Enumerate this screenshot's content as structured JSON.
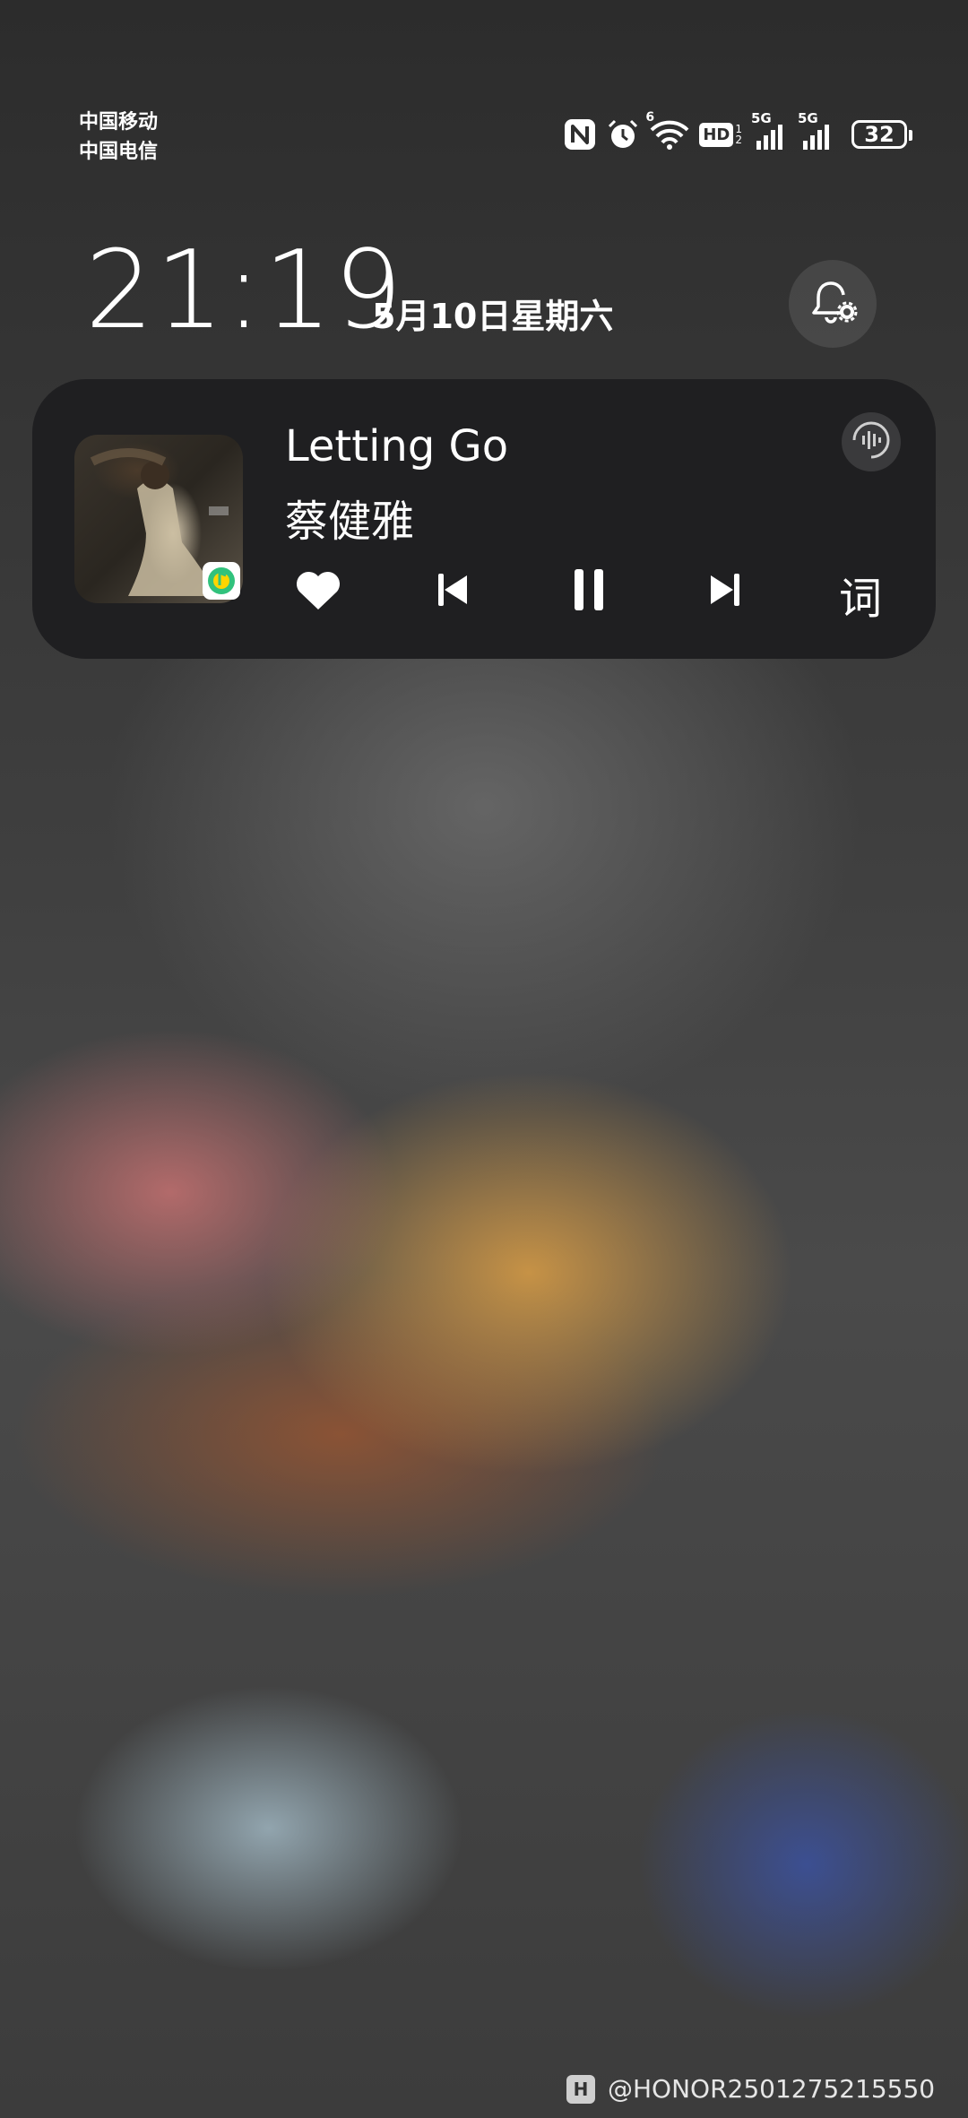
{
  "status_bar": {
    "carrier_1": "中国移动",
    "carrier_2": "中国电信",
    "wifi_label": "6",
    "hd_label": "HD",
    "hd_sim": "1\n2",
    "net1": "5G",
    "net2": "5G",
    "battery": "32",
    "icons": [
      "nfc-icon",
      "alarm-icon",
      "wifi-icon",
      "hd-voice-icon",
      "signal-icon",
      "signal-icon",
      "battery-icon"
    ]
  },
  "lockscreen": {
    "time": "21:19",
    "date": "5月10日星期六"
  },
  "music": {
    "title": "Letting Go",
    "artist": "蔡健雅",
    "lyrics_label": "词",
    "icons": [
      "favorite-heart-icon",
      "previous-track-icon",
      "pause-icon",
      "next-track-icon",
      "sound-effects-icon"
    ]
  },
  "watermark": {
    "logo": "H",
    "text": "@HONOR2501275215550"
  },
  "colors": {
    "card": "#1f1f21",
    "text": "#ffffff",
    "app_badge_green": "#31c27c",
    "app_badge_yellow": "#ffd500"
  }
}
